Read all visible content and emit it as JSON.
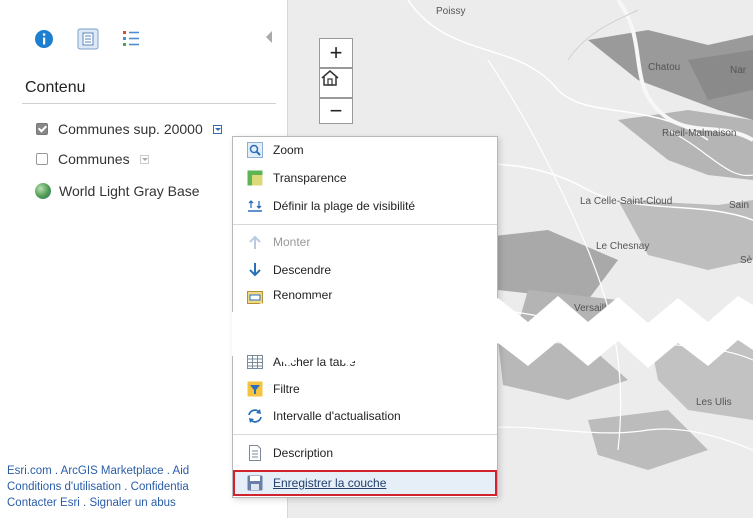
{
  "panel": {
    "toolbar": {
      "info_icon": "info-icon",
      "content_icon": "content-icon",
      "legend_icon": "legend-icon",
      "collapse_icon": "collapse-triangle-icon"
    },
    "title": "Contenu",
    "layers": [
      {
        "label": "Communes sup. 20000",
        "checked": true
      },
      {
        "label": "Communes",
        "checked": false
      },
      {
        "label": "World Light Gray Base",
        "type": "basemap"
      }
    ],
    "footer": {
      "line1": "Esri.com . ArcGIS Marketplace . Aid",
      "line2": "Conditions d'utilisation . Confidentia",
      "line3": "Contacter Esri . Signaler un abus"
    }
  },
  "map": {
    "zoom_in": "+",
    "zoom_out": "−",
    "home_icon": "home-icon",
    "labels": {
      "poissy": "Poissy",
      "chatou": "Chatou",
      "nanterre": "Nar",
      "rueil": "Rueil-Malmaison",
      "la_celle": "La Celle-Saint-Cloud",
      "saint": "Sain",
      "le_chesnay": "Le Chesnay",
      "se": "Sè",
      "versailles": "Versailles",
      "les_ulis": "Les Ulis"
    }
  },
  "menu": {
    "zoom": "Zoom",
    "transparence": "Transparence",
    "visibilite": "Définir la plage de visibilité",
    "monter": "Monter",
    "descendre": "Descendre",
    "renommer": "Renommer",
    "afficher_table": "Afficher la table",
    "filtre": "Filtre",
    "intervalle": "Intervalle d'actualisation",
    "description": "Description",
    "enregistrer": "Enregistrer la couche"
  },
  "colors": {
    "highlight_outline": "#d0232e",
    "link": "#2a5da8",
    "accent": "#1e7fd0"
  }
}
